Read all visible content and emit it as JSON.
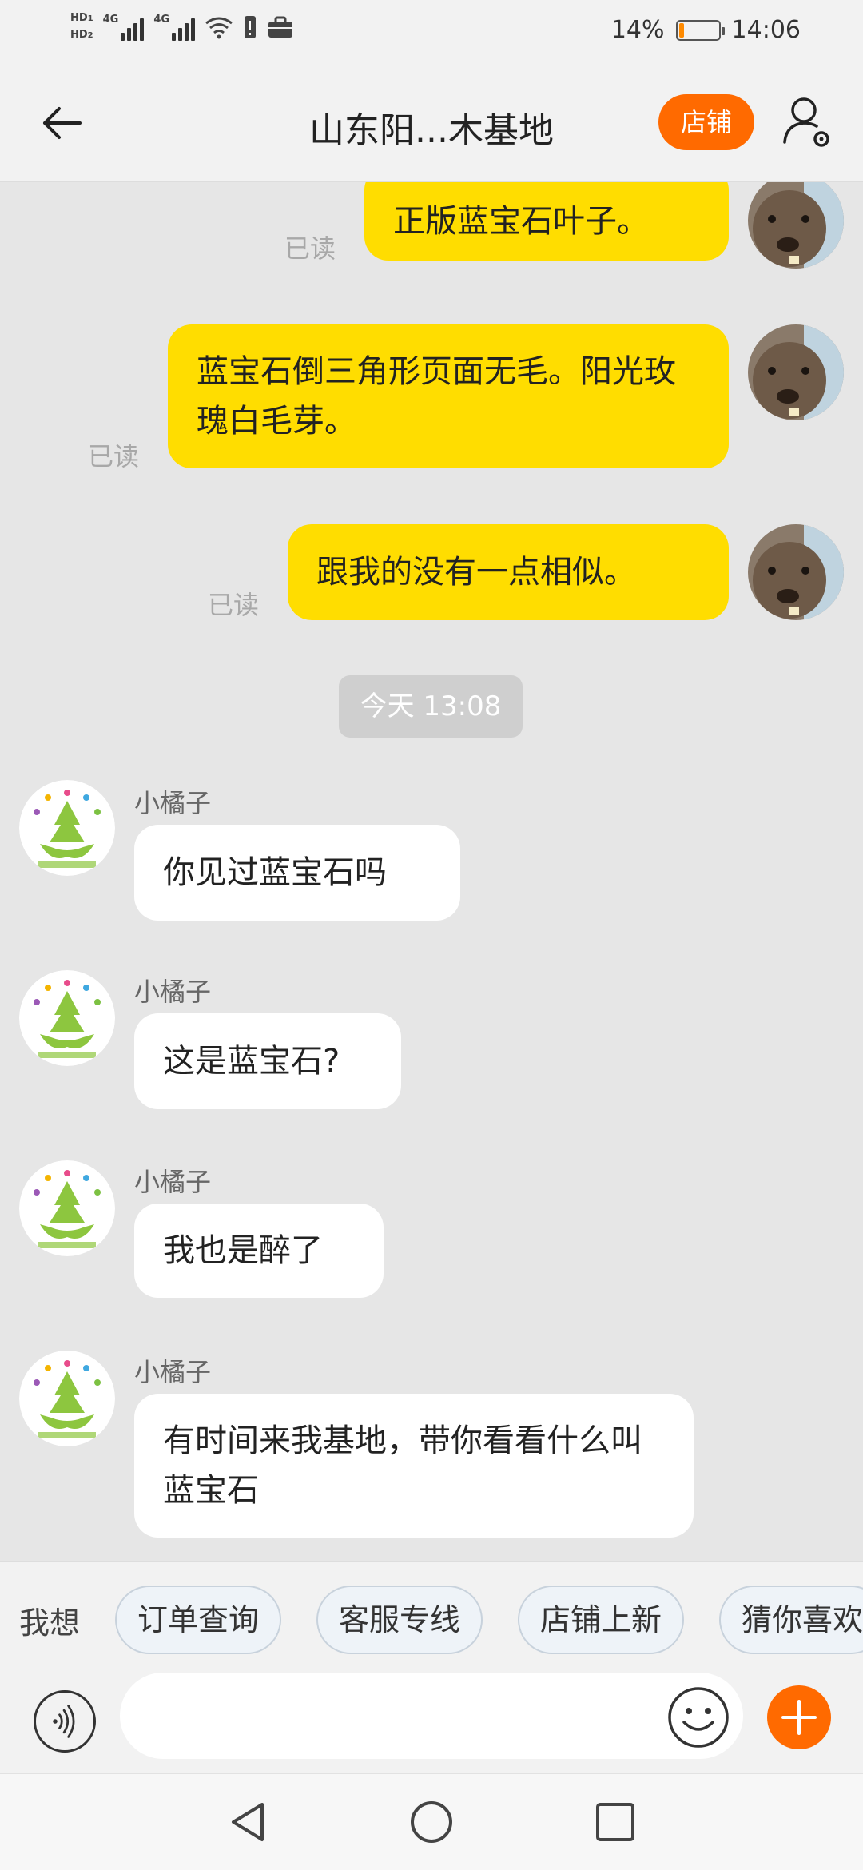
{
  "status_bar": {
    "network_1": "HD",
    "network_1_sub": "1",
    "network_2": "HD",
    "network_2_sub": "2",
    "signal_1_label": "4G",
    "signal_2_label": "4G",
    "battery_percent": "14%",
    "battery_level": 0.14,
    "time": "14:06",
    "icons": [
      "wifi-icon",
      "alert-icon",
      "briefcase-icon",
      "battery-icon"
    ]
  },
  "header": {
    "back_icon": "arrow-left-icon",
    "title": "山东阳...木基地",
    "shop_label": "店铺",
    "profile_icon": "user-settings-icon"
  },
  "colors": {
    "accent": "#ff6a00",
    "outgoing_bubble": "#ffdd00",
    "incoming_bubble": "#ffffff",
    "chat_bg": "#e6e6e6"
  },
  "messages": {
    "outgoing": [
      {
        "text": "正版蓝宝石叶子。",
        "status": "已读"
      },
      {
        "text": "蓝宝石倒三角形页面无毛。阳光玫瑰白毛芽。",
        "status": "已读"
      },
      {
        "text": "跟我的没有一点相似。",
        "status": "已读"
      }
    ],
    "timestamp": "今天  13:08",
    "incoming": [
      {
        "sender": "小橘子",
        "text": "你见过蓝宝石吗"
      },
      {
        "sender": "小橘子",
        "text": "这是蓝宝石?"
      },
      {
        "sender": "小橘子",
        "text": "我也是醉了"
      },
      {
        "sender": "小橘子",
        "text": "有时间来我基地，带你看看什么叫蓝宝石"
      }
    ]
  },
  "quick_replies": {
    "label": "我想",
    "chips": [
      "订单查询",
      "客服专线",
      "店铺上新",
      "猜你喜欢"
    ]
  },
  "input": {
    "placeholder": "",
    "voice_icon": "voice-icon",
    "emoji_icon": "emoji-icon",
    "plus_icon": "plus-icon"
  },
  "system_nav": {
    "icons": [
      "back-triangle-icon",
      "home-circle-icon",
      "recents-square-icon"
    ]
  }
}
